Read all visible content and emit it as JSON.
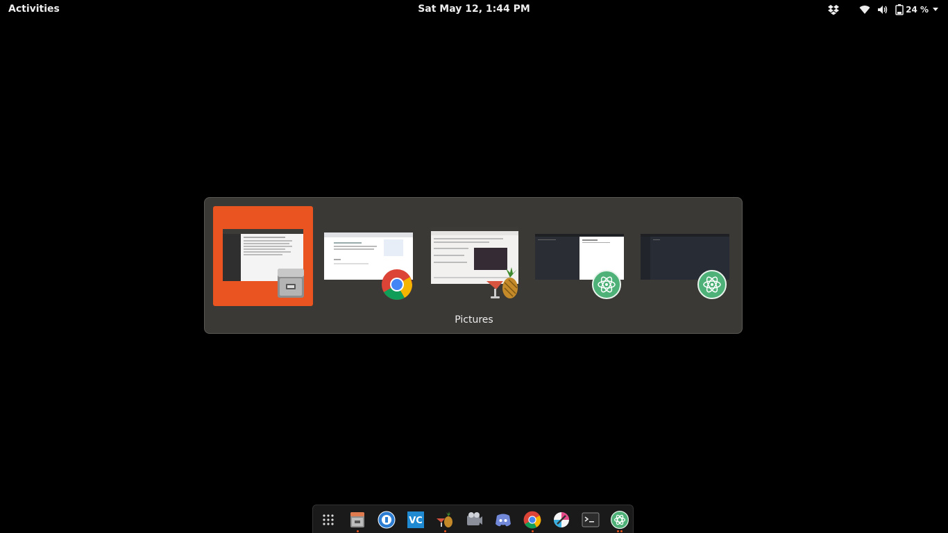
{
  "topbar": {
    "activities_label": "Activities",
    "clock": "Sat May 12,  1:44 PM",
    "battery_percent": "24 %",
    "tray_icons": [
      "dropbox-icon",
      "wifi-icon",
      "volume-icon",
      "battery-icon",
      "chevron-down-icon"
    ]
  },
  "switcher": {
    "selected_title": "Pictures",
    "windows": [
      {
        "app": "Files",
        "icon": "file-cabinet-icon",
        "selected": true
      },
      {
        "app": "Google Chrome",
        "icon": "chrome-icon",
        "selected": false
      },
      {
        "app": "HandBrake",
        "icon": "handbrake-icon",
        "selected": false
      },
      {
        "app": "Atom",
        "icon": "atom-icon",
        "selected": false
      },
      {
        "app": "Atom",
        "icon": "atom-icon",
        "selected": false
      }
    ]
  },
  "dock": {
    "items": [
      {
        "app": "Show Applications",
        "icon": "app-grid-icon",
        "running": false
      },
      {
        "app": "Files",
        "icon": "file-cabinet-icon",
        "running": true
      },
      {
        "app": "Transmission",
        "icon": "transmission-icon",
        "running": false
      },
      {
        "app": "VS Code",
        "icon": "vscode-icon",
        "running": false
      },
      {
        "app": "HandBrake",
        "icon": "handbrake-icon",
        "running": true
      },
      {
        "app": "OBS",
        "icon": "obs-icon",
        "running": false
      },
      {
        "app": "Discord",
        "icon": "discord-icon",
        "running": false
      },
      {
        "app": "Google Chrome",
        "icon": "chrome-icon",
        "running": true
      },
      {
        "app": "Krita",
        "icon": "paint-icon",
        "running": false
      },
      {
        "app": "Terminal",
        "icon": "terminal-icon",
        "running": false
      },
      {
        "app": "Atom",
        "icon": "atom-icon",
        "running": true
      }
    ]
  },
  "colors": {
    "accent": "#e95420",
    "switcher_bg": "#3b3935",
    "atom_green": "#4db178"
  }
}
